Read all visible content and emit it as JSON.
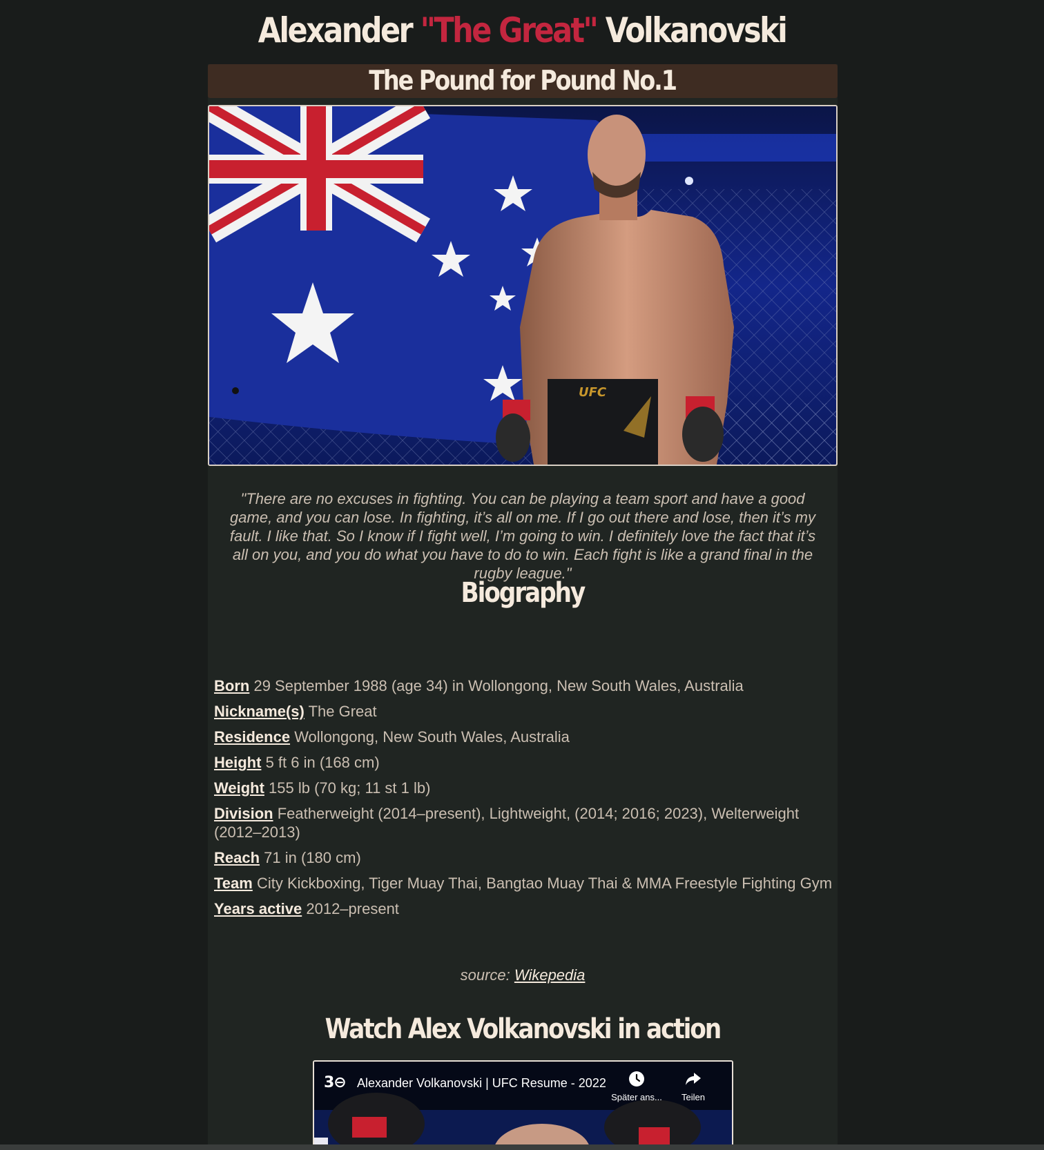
{
  "header": {
    "first_name": "Alexander",
    "nickname": "\"The Great\"",
    "last_name": "Volkanovski"
  },
  "banner": {
    "text": "The Pound for Pound No.1"
  },
  "quote": {
    "text": "\"There are no excuses in fighting. You can be playing a team sport and have a good game, and you can lose. In fighting, it’s all on me. If I go out there and lose, then it’s my fault. I like that. So I know if I fight well, I’m going to win. I definitely love the fact that it’s all on you, and you do what you have to do to win. Each fight is like a grand final in the rugby league.\""
  },
  "biography": {
    "heading": "Biography",
    "rows": [
      {
        "label": "Born",
        "value": "29 September 1988 (age 34) in Wollongong, New South Wales, Australia"
      },
      {
        "label": "Nickname(s)",
        "value": "The Great"
      },
      {
        "label": "Residence",
        "value": "Wollongong, New South Wales, Australia"
      },
      {
        "label": "Height",
        "value": "5 ft 6 in (168 cm)"
      },
      {
        "label": "Weight",
        "value": "155 lb (70 kg; 11 st 1 lb)"
      },
      {
        "label": "Division",
        "value": "Featherweight (2014–present), Lightweight, (2014; 2016; 2023), Welterweight (2012–2013)"
      },
      {
        "label": "Reach",
        "value": "71 in (180 cm)"
      },
      {
        "label": "Team",
        "value": "City Kickboxing, Tiger Muay Thai, Bangtao Muay Thai & MMA Freestyle Fighting Gym"
      },
      {
        "label": "Years active",
        "value": "2012–present"
      }
    ],
    "source_prefix": "source:",
    "source_link": "Wikepedia"
  },
  "video": {
    "heading": "Watch Alex Volkanovski in action",
    "channel_logo": "3⊖",
    "title": "Alexander Volkanovski | UFC Resume - 2022",
    "watch_later_label": "Später ans...",
    "share_label": "Teilen"
  },
  "photo": {
    "trunks_logo": "UFC"
  }
}
